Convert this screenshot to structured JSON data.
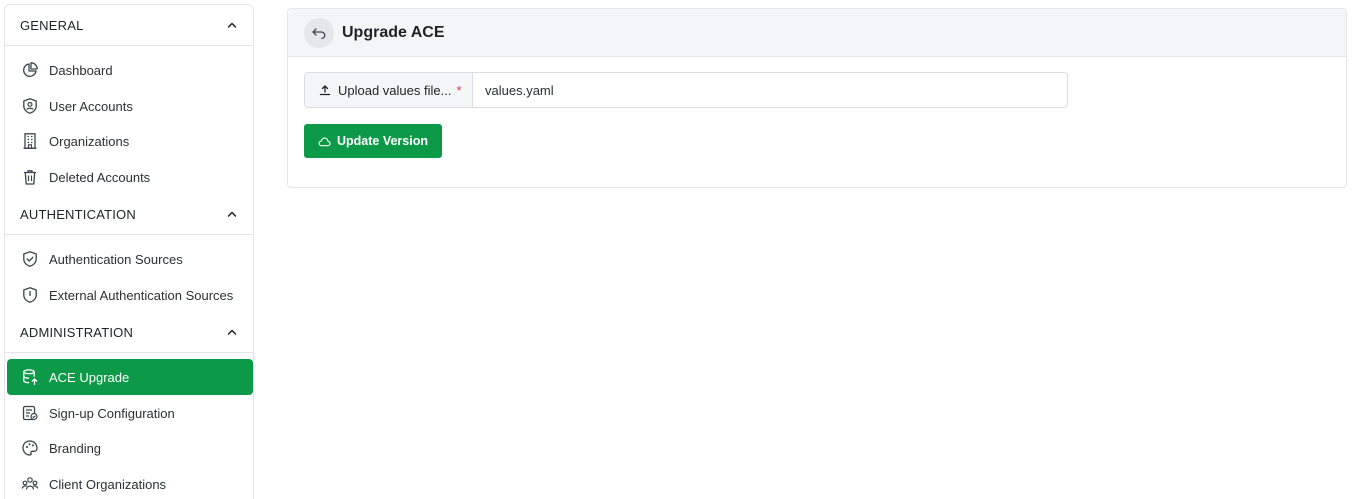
{
  "sidebar": {
    "sections": [
      {
        "label": "GENERAL",
        "icon": "chevron-up-icon"
      },
      {
        "label": "AUTHENTICATION",
        "icon": "chevron-up-icon"
      },
      {
        "label": "ADMINISTRATION",
        "icon": "chevron-up-icon"
      }
    ],
    "items": [
      {
        "label": "Dashboard",
        "icon": "pie-chart-icon"
      },
      {
        "label": "User Accounts",
        "icon": "user-shield-icon"
      },
      {
        "label": "Organizations",
        "icon": "building-icon"
      },
      {
        "label": "Deleted Accounts",
        "icon": "trash-icon"
      },
      {
        "label": "Authentication Sources",
        "icon": "shield-check-icon"
      },
      {
        "label": "External Authentication Sources",
        "icon": "shield-icon"
      },
      {
        "label": "ACE Upgrade",
        "icon": "database-upgrade-icon",
        "active": true
      },
      {
        "label": "Sign-up Configuration",
        "icon": "form-config-icon"
      },
      {
        "label": "Branding",
        "icon": "palette-icon"
      },
      {
        "label": "Client Organizations",
        "icon": "users-group-icon"
      }
    ]
  },
  "main": {
    "title": "Upgrade ACE",
    "back_icon": "back-arrow-icon",
    "upload_label": "Upload values file...",
    "required_mark": "*",
    "file_value": "values.yaml",
    "update_button": "Update Version"
  },
  "colors": {
    "accent": "#0d9a48",
    "required": "#dc3545"
  }
}
